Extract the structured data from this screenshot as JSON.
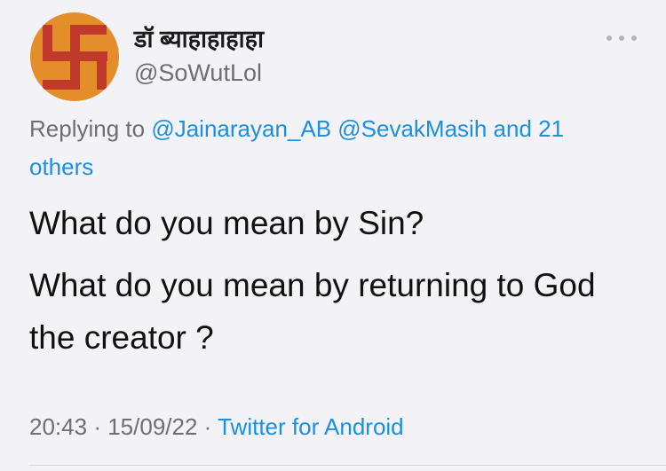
{
  "author": {
    "display_name": "डॉ ब्याहाहाहाहा",
    "handle": "@SoWutLol",
    "avatar_icon": "swastika-icon",
    "avatar_colors": {
      "background": "#e48e2b",
      "symbol": "#c0392b",
      "dots": "#e48e2b"
    }
  },
  "reply": {
    "prefix": "Replying to",
    "mention_1": "@Jainarayan_AB",
    "mention_2": "@SevakMasih",
    "and_more": "and 21 others"
  },
  "text": {
    "paragraph_1": "What do you mean by Sin?",
    "paragraph_2": "What do you mean by returning to God  the creator ?"
  },
  "meta": {
    "time": "20:43",
    "separator": "·",
    "date": "15/09/22",
    "source": "Twitter for Android"
  },
  "menu": {
    "icon": "more-horizontal-icon"
  },
  "colors": {
    "background": "#f2f2f7",
    "link": "#1d8fe0",
    "secondary_text": "#6e6e73"
  }
}
